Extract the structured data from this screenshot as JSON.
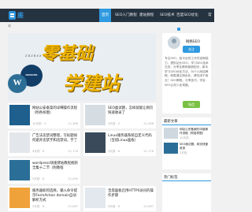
{
  "colors": {
    "nav_bg": "#25323f",
    "accent": "#2f9ae0",
    "hero_text": "#efb400"
  },
  "nav": {
    "logo_text": "座",
    "items": [
      "首页",
      "SEO入门教程",
      "建站教程",
      "SEO技术",
      "百度SEO优化",
      "常"
    ]
  },
  "breadcrumb": "站",
  "hero": {
    "line1": "零基础",
    "line2": "学建站",
    "sub": "Z B Z B X X",
    "dots": 3
  },
  "posts": [
    {
      "title": "网站公安备案的详细操作流程（附各样图）",
      "meta_left": "10天前 · 5",
      "meta_right": "21,386"
    },
    {
      "title": "SEO面试题，怎样就能让网页快速收录了",
      "meta_left": "3天前 · 5",
      "meta_right": "21,386"
    },
    {
      "title": "广告法违禁词整理，写标题如何避开违禁字和违禁词，字了",
      "meta_left": "4天前 · 6",
      "meta_right": "21,176"
    },
    {
      "title": "Linux服务器系统自定义代码（宝塔Linux面板）",
      "meta_left": "4天前 · 6",
      "meta_right": "21,176"
    },
    {
      "title": "wordpress快速建站教程视频全集十二节（附教程",
      "meta_left": "5天前 · 8",
      "meta_right": "21,095"
    },
    {
      "title": "服务器如何选择，输入命令提示FormAction domain自动解析方式",
      "meta_left": "5天前 · 6",
      "meta_right": "21,087"
    },
    {
      "title": "宝塔面板启用HTTPS访问的操作步骤",
      "meta_left": "6天前 · 6",
      "meta_right": "21,087"
    }
  ],
  "sidebar": {
    "name": "网络SEO",
    "follow_label": "关注",
    "message_label": "私信",
    "bio": "专注SEO，各平台的工作内容和能力，提供站长SEO，学习SEO技术交流，分享互联网营销知识，新手学习SEO优化方法，为个人网站教程，转载请注明出处，请勿用于商业！SEO教程，分享技巧，学会SEO让你少走弯路。",
    "recent_title": "最新文章",
    "tag_title": "热门标签"
  },
  "recent": [
    {
      "title": "网站公安备案的详细操作流程（附各样图）",
      "date": "10天前"
    },
    {
      "title": "SEO面试题，网页快速收录",
      "date": "3天前"
    }
  ]
}
